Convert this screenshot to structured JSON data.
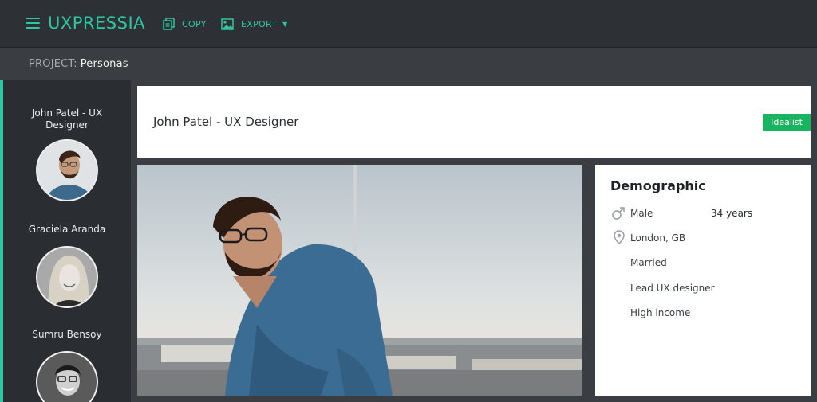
{
  "app": {
    "logo": "UXPRESSIA",
    "toolbar": {
      "copy_label": "COPY",
      "export_label": "EXPORT",
      "export_caret": "▼"
    },
    "accent_color": "#2ec7a1"
  },
  "project": {
    "label": "PROJECT:",
    "name": "Personas"
  },
  "sidebar": {
    "personas": [
      {
        "name": "John Patel - UX Designer",
        "selected": true
      },
      {
        "name": "Graciela Aranda",
        "selected": false
      },
      {
        "name": "Sumru Bensoy",
        "selected": false
      }
    ]
  },
  "persona": {
    "title": "John Patel - UX Designer",
    "badge": "Idealist",
    "badge_color": "#19b45f"
  },
  "demographic": {
    "heading": "Demographic",
    "gender": "Male",
    "age": "34 years",
    "location": "London, GB",
    "marital_status": "Married",
    "occupation": "Lead UX designer",
    "income": "High income"
  }
}
